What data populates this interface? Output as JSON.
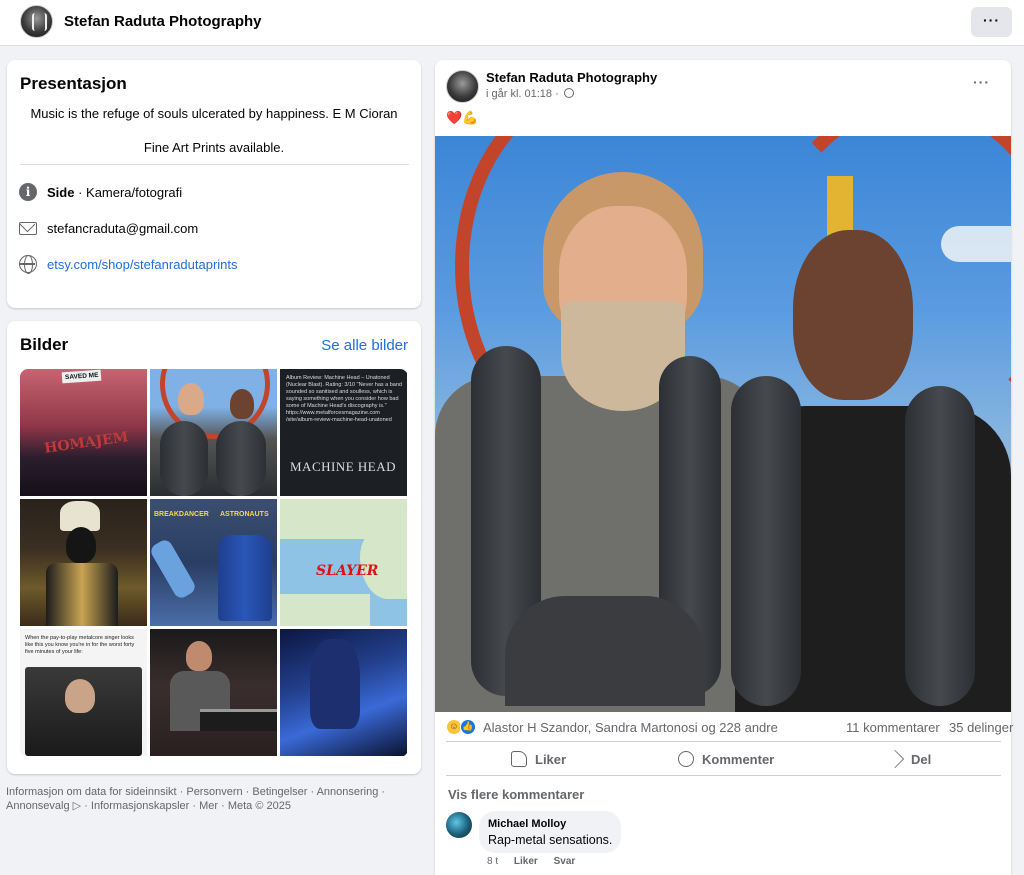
{
  "topbar": {
    "page_name": "Stefan Raduta Photography",
    "more_icon": "more-horizontal-icon",
    "more_label": "···"
  },
  "intro": {
    "title": "Presentasjon",
    "bio_line1": "Music is the refuge of souls ulcerated by happiness. E M Cioran",
    "bio_line2": "Fine Art Prints available.",
    "category_label": "Side",
    "category_value": " · Kamera/fotografi",
    "email": "stefancraduta@gmail.com",
    "website": "etsy.com/shop/stefanradutaprints"
  },
  "photos": {
    "title": "Bilder",
    "see_all": "Se alle bilder",
    "tiles": [
      {
        "saved_text": "SAVED ME",
        "logo_text": "HOMAJEM"
      },
      {},
      {
        "review_text": "Album Review: Machine Head – Unatoned (Nuclear Blast). Rating: 3/10 \"Never has a band sounded so sanitised and soulless, which is saying something when you consider how bad some of Machine Head's discography is.\" https://www.metalforcesmagazine.com /site/album-review-machine-head-unatoned",
        "band_text": "MACHINE HEAD"
      },
      {},
      {
        "left_label": "BREAKDANCER",
        "right_label": "ASTRONAUTS"
      },
      {
        "logo_text": "SLAYER"
      },
      {
        "meme_text": "When the pay-to-play metalcore singer looks like this you know you're in for the worst forty five minutes of your life:"
      },
      {},
      {}
    ]
  },
  "footer": {
    "text": "Informasjon om data for sideinnsikt · Personvern · Betingelser · Annonsering · Annonsevalg ▷ · Informasjonskapsler · Mer · Meta © 2025"
  },
  "post": {
    "author": "Stefan Raduta Photography",
    "time": "i går kl. 01:18 · ",
    "more_label": "···",
    "emoji_heart": "❤️",
    "emoji_muscle": "💪",
    "reaction_names": "Alastor H Szandor, Sandra Martonosi og 228 andre",
    "comments_count": "11 kommentarer",
    "shares_count": "35 delinger",
    "actions": {
      "like": "Liker",
      "comment": "Kommenter",
      "share": "Del"
    },
    "more_comments": "Vis flere kommentarer",
    "comment": {
      "author": "Michael Molloy",
      "text": "Rap-metal sensations.",
      "time": "8 t",
      "like": "Liker",
      "reply": "Svar"
    }
  },
  "colors": {
    "link": "#216fdb",
    "background": "#f0f2f5",
    "like_blue": "#1b74e4",
    "heart_red": "#e41e3f",
    "coaster_track": "#c2442a"
  }
}
